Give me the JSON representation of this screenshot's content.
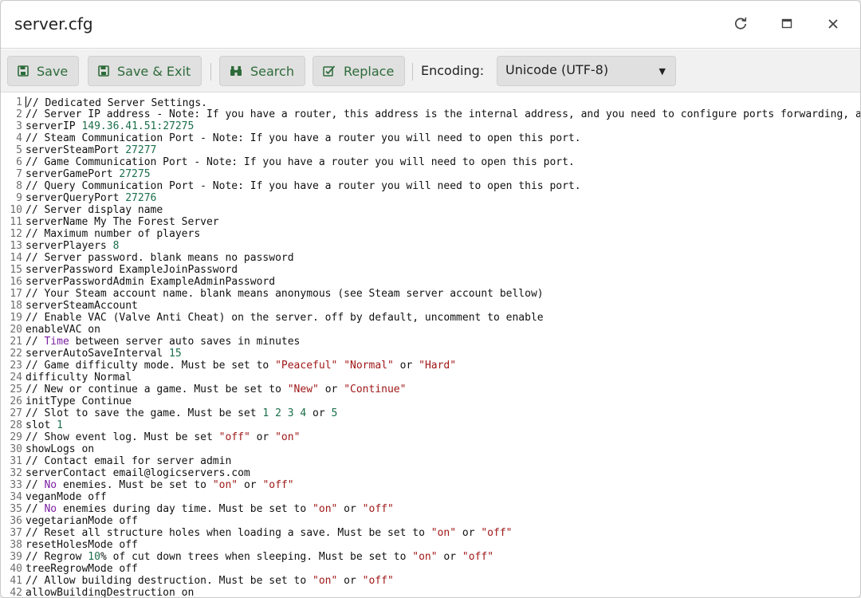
{
  "window": {
    "title": "server.cfg",
    "controls": [
      "refresh-icon",
      "maximize-icon",
      "close-icon"
    ]
  },
  "toolbar": {
    "save_label": "Save",
    "save_exit_label": "Save & Exit",
    "search_label": "Search",
    "replace_label": "Replace",
    "encoding_label": "Encoding:",
    "encoding_value": "Unicode (UTF-8)"
  },
  "colors": {
    "accent": "#2e6b3a",
    "number": "#1b6e4a",
    "string": "#a01818",
    "keyword": "#7a1fa2"
  },
  "editor": {
    "lines": [
      [
        [
          "// Dedicated Server Settings.",
          "t"
        ]
      ],
      [
        [
          "// Server IP address - Note: If you have a router, this address is the internal address, and you need to configure ports forwarding, a",
          "t"
        ]
      ],
      [
        [
          "serverIP ",
          "t"
        ],
        [
          "149.36.41.51:27275",
          "n"
        ]
      ],
      [
        [
          "// Steam Communication Port - Note: If you have a router you will need to open this port.",
          "t"
        ]
      ],
      [
        [
          "serverSteamPort ",
          "t"
        ],
        [
          "27277",
          "n"
        ]
      ],
      [
        [
          "// Game Communication Port - Note: If you have a router you will need to open this port.",
          "t"
        ]
      ],
      [
        [
          "serverGamePort ",
          "t"
        ],
        [
          "27275",
          "n"
        ]
      ],
      [
        [
          "// Query Communication Port - Note: If you have a router you will need to open this port.",
          "t"
        ]
      ],
      [
        [
          "serverQueryPort ",
          "t"
        ],
        [
          "27276",
          "n"
        ]
      ],
      [
        [
          "// Server display name",
          "t"
        ]
      ],
      [
        [
          "serverName My The Forest Server",
          "t"
        ]
      ],
      [
        [
          "// Maximum number of players",
          "t"
        ]
      ],
      [
        [
          "serverPlayers ",
          "t"
        ],
        [
          "8",
          "n"
        ]
      ],
      [
        [
          "// Server password. blank means no password",
          "t"
        ]
      ],
      [
        [
          "serverPassword ExampleJoinPassword",
          "t"
        ]
      ],
      [
        [
          "serverPasswordAdmin ExampleAdminPassword",
          "t"
        ]
      ],
      [
        [
          "// Your Steam account name. blank means anonymous (see Steam server account bellow)",
          "t"
        ]
      ],
      [
        [
          "serverSteamAccount",
          "t"
        ]
      ],
      [
        [
          "// Enable VAC (Valve Anti Cheat) on the server. off by default, uncomment to enable",
          "t"
        ]
      ],
      [
        [
          "enableVAC on",
          "t"
        ]
      ],
      [
        [
          "// ",
          "t"
        ],
        [
          "Time",
          "k"
        ],
        [
          " between server auto saves in minutes",
          "t"
        ]
      ],
      [
        [
          "serverAutoSaveInterval ",
          "t"
        ],
        [
          "15",
          "n"
        ]
      ],
      [
        [
          "// Game difficulty mode. Must be set to ",
          "t"
        ],
        [
          "\"Peaceful\"",
          "s"
        ],
        [
          " ",
          "t"
        ],
        [
          "\"Normal\"",
          "s"
        ],
        [
          " or ",
          "t"
        ],
        [
          "\"Hard\"",
          "s"
        ]
      ],
      [
        [
          "difficulty Normal",
          "t"
        ]
      ],
      [
        [
          "// New or continue a game. Must be set to ",
          "t"
        ],
        [
          "\"New\"",
          "s"
        ],
        [
          " or ",
          "t"
        ],
        [
          "\"Continue\"",
          "s"
        ]
      ],
      [
        [
          "initType Continue",
          "t"
        ]
      ],
      [
        [
          "// Slot to save the game. Must be set ",
          "t"
        ],
        [
          "1 2 3 4",
          "n"
        ],
        [
          " or ",
          "t"
        ],
        [
          "5",
          "n"
        ]
      ],
      [
        [
          "slot ",
          "t"
        ],
        [
          "1",
          "n"
        ]
      ],
      [
        [
          "// Show event log. Must be set ",
          "t"
        ],
        [
          "\"off\"",
          "s"
        ],
        [
          " or ",
          "t"
        ],
        [
          "\"on\"",
          "s"
        ]
      ],
      [
        [
          "showLogs on",
          "t"
        ]
      ],
      [
        [
          "// Contact email for server admin",
          "t"
        ]
      ],
      [
        [
          "serverContact email@logicservers.com",
          "t"
        ]
      ],
      [
        [
          "// ",
          "t"
        ],
        [
          "No",
          "k"
        ],
        [
          " enemies. Must be set to ",
          "t"
        ],
        [
          "\"on\"",
          "s"
        ],
        [
          " or ",
          "t"
        ],
        [
          "\"off\"",
          "s"
        ]
      ],
      [
        [
          "veganMode off",
          "t"
        ]
      ],
      [
        [
          "// ",
          "t"
        ],
        [
          "No",
          "k"
        ],
        [
          " enemies during day time. Must be set to ",
          "t"
        ],
        [
          "\"on\"",
          "s"
        ],
        [
          " or ",
          "t"
        ],
        [
          "\"off\"",
          "s"
        ]
      ],
      [
        [
          "vegetarianMode off",
          "t"
        ]
      ],
      [
        [
          "// Reset all structure holes when loading a save. Must be set to ",
          "t"
        ],
        [
          "\"on\"",
          "s"
        ],
        [
          " or ",
          "t"
        ],
        [
          "\"off\"",
          "s"
        ]
      ],
      [
        [
          "resetHolesMode off",
          "t"
        ]
      ],
      [
        [
          "// Regrow ",
          "t"
        ],
        [
          "10",
          "n"
        ],
        [
          "% of cut down trees when sleeping. Must be set to ",
          "t"
        ],
        [
          "\"on\"",
          "s"
        ],
        [
          " or ",
          "t"
        ],
        [
          "\"off\"",
          "s"
        ]
      ],
      [
        [
          "treeRegrowMode off",
          "t"
        ]
      ],
      [
        [
          "// Allow building destruction. Must be set to ",
          "t"
        ],
        [
          "\"on\"",
          "s"
        ],
        [
          " or ",
          "t"
        ],
        [
          "\"off\"",
          "s"
        ]
      ],
      [
        [
          "allowBuildingDestruction on",
          "t"
        ]
      ]
    ]
  }
}
